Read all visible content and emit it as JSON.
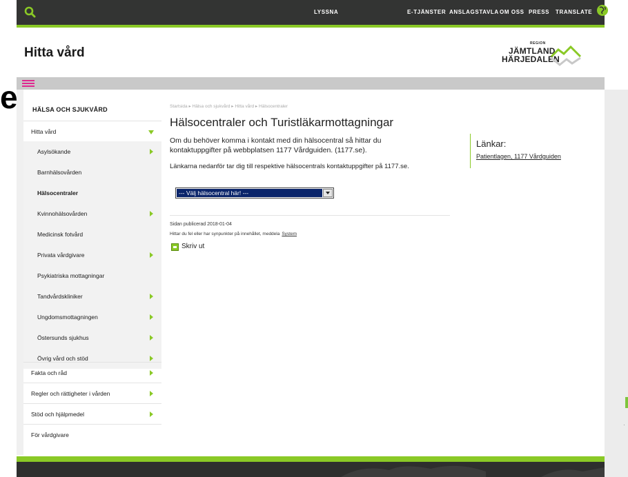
{
  "topbar": {
    "links": [
      "LYSSNA",
      "E-TJÄNSTER",
      "ANSLAGSTAVLA",
      "OM OSS",
      "PRESS",
      "TRANSLATE"
    ]
  },
  "header": {
    "title": "Hitta vård",
    "logo": {
      "region": "REGION",
      "line1": "JÄMTLAND",
      "line2": "HÄRJEDALEN"
    }
  },
  "page_edge": {
    "left_letter": "e"
  },
  "sidebar": {
    "heading": "HÄLSA OCH SJUKVÅRD",
    "items": [
      {
        "label": "Hitta vård"
      },
      {
        "label": "Asylsökande"
      },
      {
        "label": "Barnhälsovården"
      },
      {
        "label": "Hälsocentraler"
      },
      {
        "label": "Kvinnohälsovården"
      },
      {
        "label": "Medicinsk fotvård"
      },
      {
        "label": "Privata vårdgivare"
      },
      {
        "label": "Psykiatriska mottagningar"
      },
      {
        "label": "Tandvårdskliniker"
      },
      {
        "label": "Ungdomsmottagningen"
      },
      {
        "label": "Östersunds sjukhus"
      },
      {
        "label": "Övrig vård och stöd"
      },
      {
        "label": "Fakta och råd"
      },
      {
        "label": "Regler och rättigheter i vården"
      },
      {
        "label": "Stöd och hjälpmedel"
      },
      {
        "label": "För vårdgivare"
      }
    ]
  },
  "main": {
    "breadcrumb": "Startsida ▸ Hälsa och sjukvård ▸ Hitta vård ▸ Hälsocentraler",
    "heading": "Hälsocentraler och Turistläkarmottagningar",
    "intro": "Om du behöver komma i kontakt med din hälsocentral så hittar du kontaktuppgifter på webbplatsen 1177 Vårdguiden. (1177.se).",
    "intro2": "Länkarna nedanför tar dig till respektive hälsocentrals kontaktuppgifter på 1177.se.",
    "select_value": "--- Välj hälsocentral här! ---",
    "published": "Sidan publicerad 2018-01-04",
    "feedback_text": "Hittar du fel eller har synpunkter på innehållet, meddela",
    "feedback_link": "System",
    "print_label": "Skriv ut"
  },
  "links_panel": {
    "heading": "Länkar:",
    "item": "Patientlagen, 1177 Vårdguiden"
  },
  "colors": {
    "accent": "#8ac926",
    "topbar": "#333433",
    "hamburger": "#e0268f",
    "select_highlight": "#0a246a"
  }
}
